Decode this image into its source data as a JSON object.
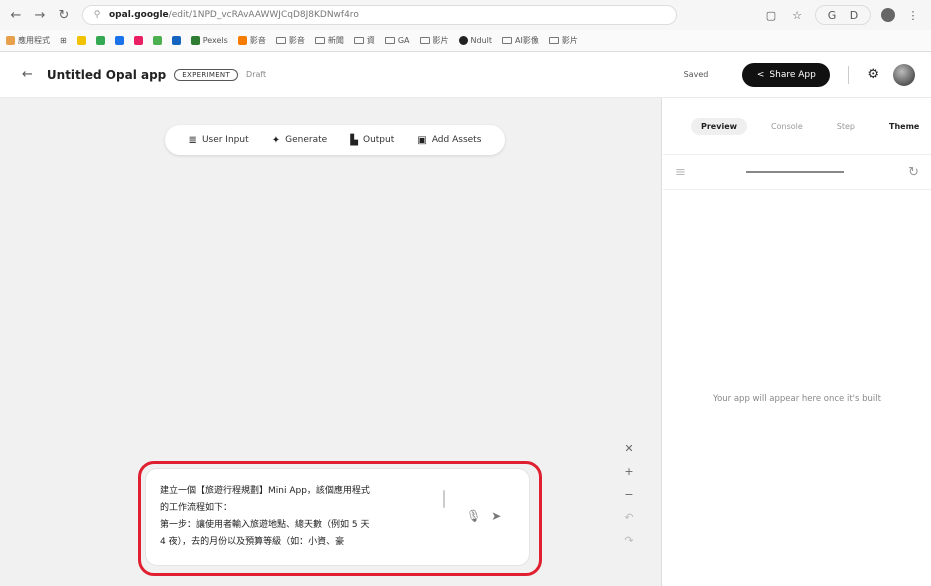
{
  "browser": {
    "nav": {
      "back": "←",
      "forward": "→",
      "reload": "↻"
    },
    "url_host": "opal.google",
    "url_path": "/edit/1NPD_vcRAvAAWWJCqD8J8KDNwf4ro",
    "right_icons": [
      "tabs-icon",
      "star-icon",
      "extension-icon",
      "profile-icon",
      "menu-icon"
    ],
    "bookmarks": [
      "應用程式",
      "Pexels",
      "影音",
      "影音",
      "新聞",
      "資",
      "GA",
      "影片",
      "Ndult",
      "AI影像",
      "影片"
    ]
  },
  "header": {
    "title": "Untitled Opal app",
    "badge": "EXPERIMENT",
    "status": "Draft",
    "saved": "Saved",
    "share_label": "Share App"
  },
  "toolbar": {
    "user_input": "User Input",
    "generate": "Generate",
    "output": "Output",
    "add_assets": "Add Assets"
  },
  "prompt": {
    "line1": "建立一個【旅遊行程規劃】Mini App，該個應用程式",
    "line2": "的工作流程如下：",
    "line3": "第一步：讓使用者輸入旅遊地點、總天數（例如 5 天",
    "line4": "4 夜），去的月份以及預算等級（如：小資、豪"
  },
  "panel": {
    "tabs": [
      "Preview",
      "Console",
      "Step",
      "Theme"
    ],
    "active_tab": "Preview",
    "empty_message": "Your app will appear here once it's built"
  },
  "colors": {
    "highlight": "#e02030",
    "share_button": "#111111",
    "canvas_bg": "#f1f1f1"
  }
}
